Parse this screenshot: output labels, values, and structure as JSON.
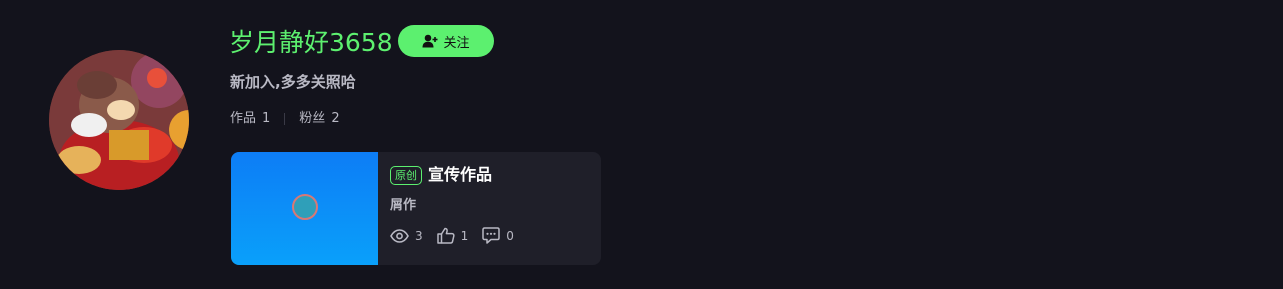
{
  "profile": {
    "username": "岁月静好3658",
    "follow_label": "关注",
    "bio": "新加入,多多关照哈",
    "stats": [
      {
        "label": "作品",
        "value": "1"
      },
      {
        "label": "粉丝",
        "value": "2"
      }
    ]
  },
  "work": {
    "badge": "原创",
    "title": "宣传作品",
    "category": "屑作",
    "views": "3",
    "likes": "1",
    "comments": "0"
  },
  "icons": {
    "follow": "add-user-icon",
    "views": "eye-icon",
    "likes": "thumbs-up-icon",
    "comments": "comment-icon"
  },
  "colors": {
    "accent": "#5cf06f",
    "background": "#13131c",
    "card": "#1f1f29",
    "muted_text": "#b9b9c4"
  }
}
